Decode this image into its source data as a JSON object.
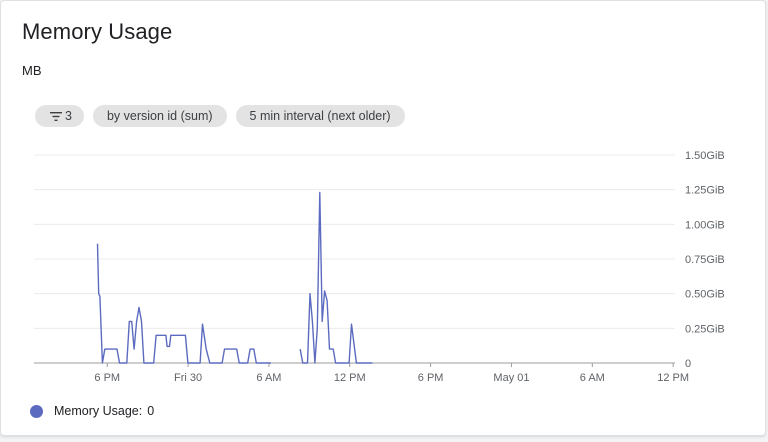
{
  "card": {
    "title": "Memory Usage",
    "unit": "MB"
  },
  "chips": {
    "filter_count": "3",
    "group_by": "by version id (sum)",
    "interval": "5 min interval (next older)"
  },
  "legend": {
    "label": "Memory Usage:",
    "value": "0",
    "color": "#5c6bc0"
  },
  "chart_data": {
    "type": "line",
    "title": "Memory Usage",
    "ylabel": "MB",
    "y_ticks": [
      "0",
      "0.25GiB",
      "0.50GiB",
      "0.75GiB",
      "1.00GiB",
      "1.25GiB",
      "1.50GiB"
    ],
    "ylim": [
      0,
      1.5
    ],
    "x_ticks": [
      "6 PM",
      "Fri 30",
      "6 AM",
      "12 PM",
      "6 PM",
      "May 01",
      "6 AM",
      "12 PM"
    ],
    "xlim": [
      0,
      52
    ],
    "series": [
      {
        "name": "Memory Usage",
        "color": "#5c6bc0",
        "segments": [
          [
            [
              5.2,
              0.86
            ],
            [
              5.3,
              0.5
            ],
            [
              5.4,
              0.48
            ],
            [
              5.6,
              0.0
            ],
            [
              5.8,
              0.1
            ],
            [
              6.8,
              0.1
            ],
            [
              7.0,
              0.0
            ],
            [
              7.6,
              0.0
            ],
            [
              7.8,
              0.3
            ],
            [
              8.0,
              0.3
            ],
            [
              8.2,
              0.1
            ],
            [
              8.4,
              0.3
            ],
            [
              8.6,
              0.4
            ],
            [
              8.8,
              0.3
            ],
            [
              9.0,
              0.0
            ],
            [
              9.8,
              0.0
            ],
            [
              10.0,
              0.2
            ],
            [
              10.8,
              0.2
            ],
            [
              10.9,
              0.12
            ],
            [
              11.1,
              0.12
            ],
            [
              11.2,
              0.2
            ],
            [
              12.4,
              0.2
            ],
            [
              12.6,
              0.0
            ],
            [
              13.6,
              0.0
            ],
            [
              13.8,
              0.28
            ],
            [
              14.1,
              0.1
            ],
            [
              14.4,
              0.0
            ],
            [
              15.4,
              0.0
            ],
            [
              15.6,
              0.1
            ],
            [
              16.6,
              0.1
            ],
            [
              16.8,
              0.0
            ],
            [
              17.5,
              0.0
            ],
            [
              17.7,
              0.1
            ],
            [
              18.0,
              0.1
            ],
            [
              18.2,
              0.0
            ],
            [
              19.4,
              0.0
            ]
          ],
          [
            [
              21.8,
              0.1
            ],
            [
              22.0,
              0.0
            ],
            [
              22.4,
              0.0
            ],
            [
              22.6,
              0.5
            ],
            [
              22.8,
              0.3
            ],
            [
              23.0,
              0.0
            ],
            [
              23.2,
              0.25
            ],
            [
              23.4,
              1.23
            ],
            [
              23.6,
              0.3
            ],
            [
              23.8,
              0.52
            ],
            [
              24.0,
              0.45
            ],
            [
              24.2,
              0.1
            ],
            [
              24.5,
              0.1
            ],
            [
              24.7,
              0.0
            ],
            [
              25.8,
              0.0
            ],
            [
              26.0,
              0.28
            ],
            [
              26.4,
              0.0
            ],
            [
              27.7,
              0.0
            ]
          ]
        ]
      }
    ]
  }
}
